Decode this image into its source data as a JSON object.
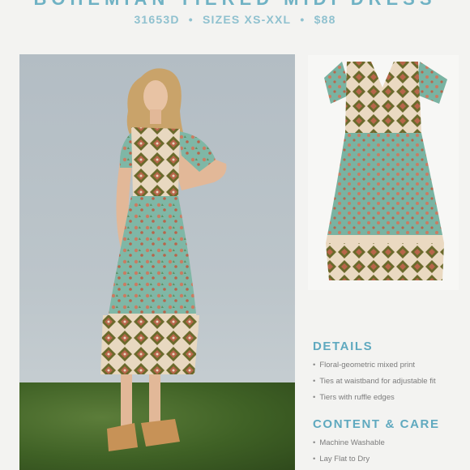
{
  "header": {
    "title": "BOHEMIAN TIERED MIDI DRESS",
    "style_code": "31653D",
    "sizes": "SIZES XS-XXL",
    "price": "$88",
    "separator": "•"
  },
  "images": {
    "model_photo": "model-wearing-dress-photo",
    "product_photo": "dress-flat-product-photo"
  },
  "details": {
    "heading": "DETAILS",
    "items": [
      "Floral-geometric mixed print",
      "Ties at waistband for adjustable fit",
      "Tiers with ruffle edges"
    ]
  },
  "content_care": {
    "heading": "CONTENT & CARE",
    "items": [
      "Machine Washable",
      "Lay Flat to Dry"
    ]
  },
  "colors": {
    "accent": "#5fa9bf",
    "dress_teal": "#7fb7a6",
    "print_rust": "#b8654a",
    "print_olive": "#6b6a2c"
  }
}
